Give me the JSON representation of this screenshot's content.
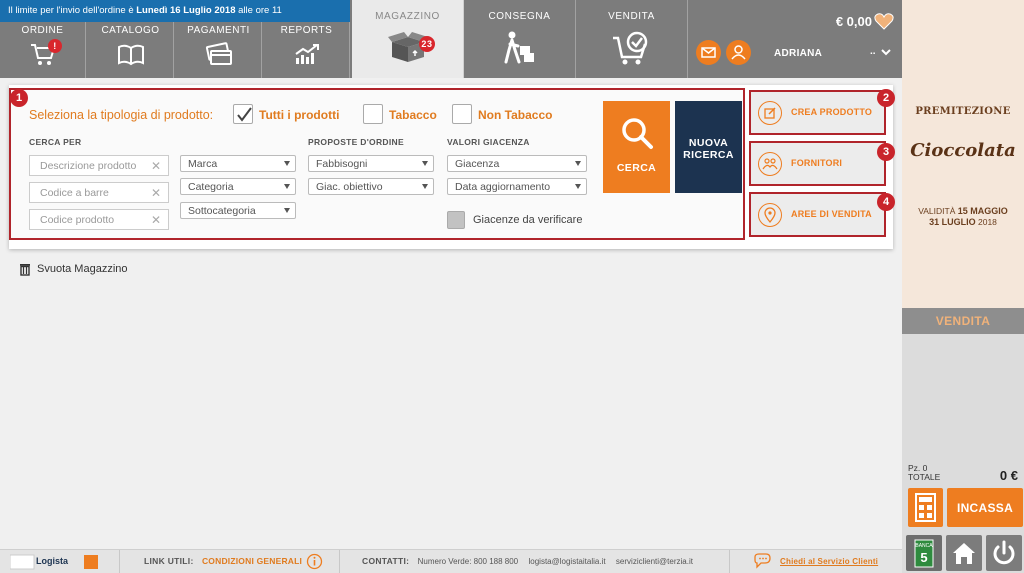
{
  "header": {
    "notice_prefix": "Il limite per l'invio dell'ordine è",
    "notice_date": "Lunedì 16 Luglio 2018",
    "notice_suffix": "alle ore 11",
    "tabs": [
      {
        "label": "ORDINE",
        "badge": "!"
      },
      {
        "label": "CATALOGO"
      },
      {
        "label": "PAGAMENTI"
      },
      {
        "label": "REPORTS"
      },
      {
        "label": "MAGAZZINO",
        "badge": "23"
      },
      {
        "label": "CONSEGNA"
      },
      {
        "label": "VENDITA"
      }
    ],
    "balance": "€ 0,00",
    "username": "ADRIANA",
    "username_suffix": ".."
  },
  "search": {
    "marker": "1",
    "title": "Seleziona la tipologia di prodotto:",
    "types": [
      {
        "label": "Tutti i prodotti",
        "checked": true
      },
      {
        "label": "Tabacco",
        "checked": false
      },
      {
        "label": "Non Tabacco",
        "checked": false
      }
    ],
    "cerca_per_label": "CERCA PER",
    "inputs": [
      {
        "placeholder": "Descrizione prodotto"
      },
      {
        "placeholder": "Codice a barre"
      },
      {
        "placeholder": "Codice prodotto"
      }
    ],
    "dropdowns_col1": [
      "Marca",
      "Categoria",
      "Sottocategoria"
    ],
    "proposte_label": "PROPOSTE D'ORDINE",
    "dropdowns_col2": [
      "Fabbisogni",
      "Giac. obiettivo"
    ],
    "valori_label": "VALORI GIACENZA",
    "dropdowns_col3": [
      "Giacenza",
      "Data aggiornamento"
    ],
    "giacenze_verificare": "Giacenze da verificare",
    "cerca_button": "CERCA",
    "nuova_line1": "NUOVA",
    "nuova_line2": "RICERCA"
  },
  "actions": [
    {
      "marker": "2",
      "label": "CREA PRODOTTO",
      "icon": "edit-icon"
    },
    {
      "marker": "3",
      "label": "FORNITORI",
      "icon": "people-icon"
    },
    {
      "marker": "4",
      "label": "AREE DI VENDITA",
      "icon": "location-pin-icon"
    }
  ],
  "svuota": "Svuota Magazzino",
  "promo": {
    "brand": "PREMITEZIONE",
    "product": "Cioccolata",
    "validity_label": "VALIDITÀ",
    "date_from": "15 MAGGIO",
    "date_to": "31 LUGLIO",
    "year": "2018"
  },
  "sidebar": {
    "vendita_label": "VENDITA",
    "pz": "Pz. 0",
    "totale_label": "TOTALE",
    "total": "0 €",
    "incassa": "INCASSA",
    "banca_label": "BANCA",
    "banca_number": "5"
  },
  "footer": {
    "logo": "Logista",
    "link_utili_label": "LINK UTILI:",
    "condizioni": "CONDIZIONI GENERALI",
    "contatti_label": "CONTATTI:",
    "numero_verde": "Numero Verde: 800 188 800",
    "email1": "logista@logistaitalia.it",
    "email2": "serviziclienti@terzia.it",
    "chiedi": "Chiedi al Servizio Clienti"
  },
  "colors": {
    "orange": "#ee7d20",
    "navy": "#1c3350",
    "red": "#c9242b",
    "gray": "#7c7c7c",
    "blue": "#1a6fae"
  }
}
